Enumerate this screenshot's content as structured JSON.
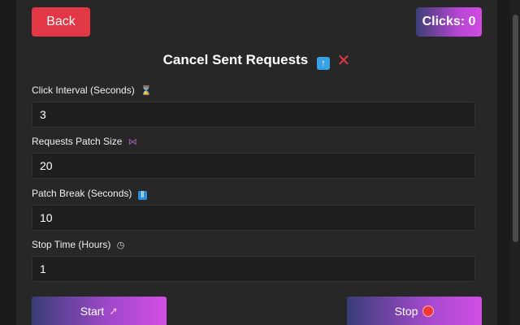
{
  "header": {
    "back_label": "Back",
    "clicks_label": "Clicks: 0"
  },
  "title": {
    "text": "Cancel Sent Requests",
    "icons": [
      "up-arrow-icon",
      "cross-icon"
    ]
  },
  "fields": [
    {
      "label": "Click Interval (Seconds)",
      "icon": "hourglass-icon",
      "value": "3"
    },
    {
      "label": "Requests Patch Size",
      "icon": "butterfly-icon",
      "value": "20"
    },
    {
      "label": "Patch Break (Seconds)",
      "icon": "pause-icon",
      "value": "10"
    },
    {
      "label": "Stop Time (Hours)",
      "icon": "clock-icon",
      "value": "1"
    }
  ],
  "actions": {
    "start_label": "Start",
    "start_icon": "rocket-icon",
    "stop_label": "Stop",
    "stop_icon": "red-circle-icon"
  },
  "colors": {
    "back": "#e23744",
    "gradient_from": "#383e77",
    "gradient_to": "#d24ee4",
    "panel": "#272727"
  }
}
